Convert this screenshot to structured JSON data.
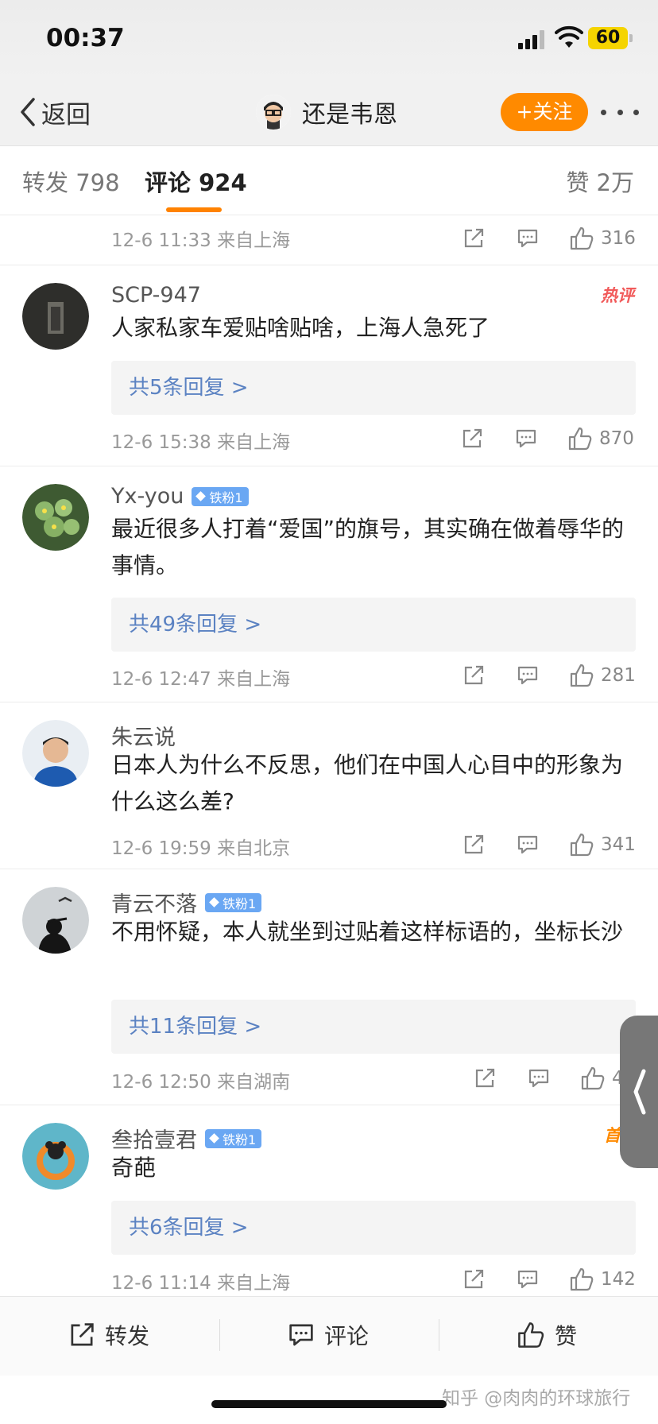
{
  "status_bar": {
    "time": "00:37",
    "battery": "60"
  },
  "nav": {
    "back_label": "返回",
    "title": "还是韦恩",
    "follow_label": "+关注"
  },
  "tabs": {
    "repost": "转发 798",
    "comments": "评论 924",
    "likes": "赞 2万"
  },
  "top_partial": {
    "meta": "12-6 11:33 来自上海",
    "likes": "316"
  },
  "comments": [
    {
      "name": "SCP-947",
      "badge": "热评",
      "text": "人家私家车爱贴啥贴啥，上海人急死了",
      "replies": "共5条回复 >",
      "meta": "12-6 15:38 来自上海",
      "likes": "870"
    },
    {
      "name": "Yx-you",
      "fan_badge": "铁粉1",
      "text": "最近很多人打着“爱国”的旗号，其实确在做着辱华的事情。",
      "replies": "共49条回复 >",
      "meta": "12-6 12:47 来自上海",
      "likes": "281"
    },
    {
      "name": "朱云说",
      "text": "日本人为什么不反思，他们在中国人心目中的形象为什么这么差?",
      "meta": "12-6 19:59 来自北京",
      "likes": "341"
    },
    {
      "name": "青云不落",
      "fan_badge": "铁粉1",
      "text": "不用怀疑，本人就坐到过贴着这样标语的，坐标长沙",
      "replies": "共11条回复 >",
      "meta": "12-6 12:50 来自湖南",
      "likes": "4"
    },
    {
      "name": "叁拾壹君",
      "fan_badge": "铁粉1",
      "badge": "首评",
      "text": "奇葩",
      "replies": "共6条回复 >",
      "meta": "12-6 11:14 来自上海",
      "likes": "142"
    }
  ],
  "bottom_bar": {
    "repost": "转发",
    "comment": "评论",
    "like": "赞"
  },
  "watermark": "知乎 @肉肉的环球旅行",
  "colors": {
    "accent": "#ff8200",
    "reply_link": "#5b82c2",
    "fan_badge": "#6aa7f3"
  },
  "icons": [
    "back-chevron-icon",
    "share-icon",
    "comment-icon",
    "like-icon",
    "more-icon",
    "signal-icon",
    "wifi-icon",
    "battery-icon"
  ]
}
